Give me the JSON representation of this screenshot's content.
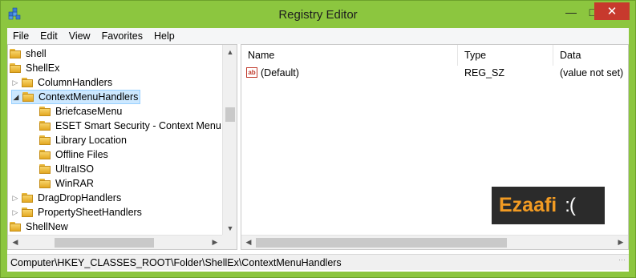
{
  "window": {
    "title": "Registry Editor"
  },
  "menu": [
    "File",
    "Edit",
    "View",
    "Favorites",
    "Help"
  ],
  "tree": [
    {
      "label": "shell",
      "indent": 0,
      "arrow": ""
    },
    {
      "label": "ShellEx",
      "indent": 0,
      "arrow": ""
    },
    {
      "label": "ColumnHandlers",
      "indent": 1,
      "arrow": "▷"
    },
    {
      "label": "ContextMenuHandlers",
      "indent": 1,
      "arrow": "◢",
      "selected": true
    },
    {
      "label": "BriefcaseMenu",
      "indent": 2,
      "arrow": ""
    },
    {
      "label": "ESET Smart Security - Context Menu Sh",
      "indent": 2,
      "arrow": ""
    },
    {
      "label": "Library Location",
      "indent": 2,
      "arrow": ""
    },
    {
      "label": "Offline Files",
      "indent": 2,
      "arrow": ""
    },
    {
      "label": "UltraISO",
      "indent": 2,
      "arrow": ""
    },
    {
      "label": "WinRAR",
      "indent": 2,
      "arrow": ""
    },
    {
      "label": "DragDropHandlers",
      "indent": 1,
      "arrow": "▷"
    },
    {
      "label": "PropertySheetHandlers",
      "indent": 1,
      "arrow": "▷"
    },
    {
      "label": "ShellNew",
      "indent": 0,
      "arrow": ""
    }
  ],
  "list": {
    "columns": [
      "Name",
      "Type",
      "Data"
    ],
    "rows": [
      {
        "name": "(Default)",
        "type": "REG_SZ",
        "data": "(value not set)"
      }
    ]
  },
  "watermark": {
    "text": "Ezaafi",
    "face": ":("
  },
  "status": "Computer\\HKEY_CLASSES_ROOT\\Folder\\ShellEx\\ContextMenuHandlers"
}
